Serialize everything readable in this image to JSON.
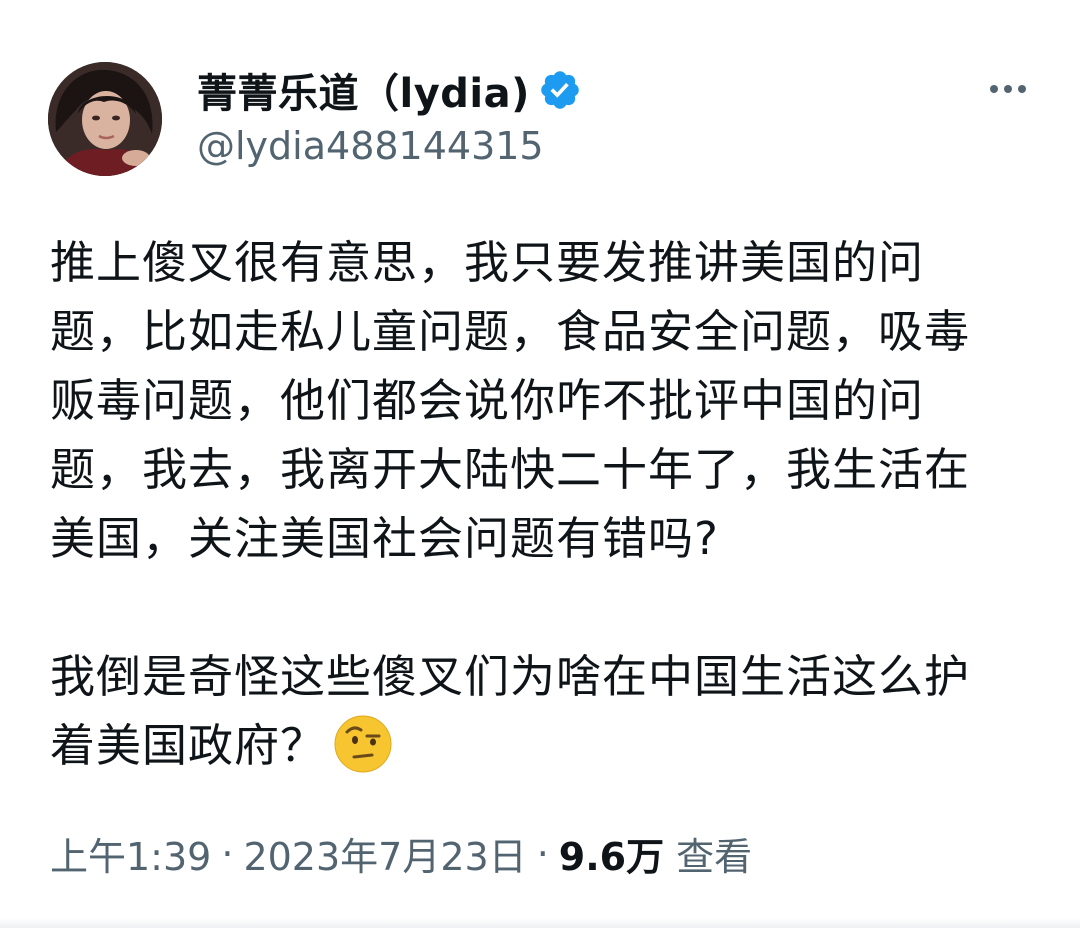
{
  "tweet": {
    "display_name": "菁菁乐道（lydia)",
    "handle": "@lydia488144315",
    "verified_badge_icon": "verified-check-icon",
    "more_icon": "more-horizontal-icon",
    "paragraphs": [
      "推上傻叉很有意思，我只要发推讲美国的问\n题，比如走私儿童问题，食品安全问题，吸毒\n贩毒问题，他们都会说你咋不批评中国的问\n题，我去，我离开大陆快二十年了，我生活在\n美国，关注美国社会问题有错吗?",
      "我倒是奇怪这些傻叉们为啥在中国生活这么护\n着美国政府？"
    ],
    "emoji": "face-with-raised-eyebrow-emoji",
    "time": "上午1:39",
    "separator": "·",
    "date": "2023年7月23日",
    "views_count": "9.6万",
    "views_label": "查看"
  },
  "colors": {
    "text_primary": "#0f1419",
    "text_secondary": "#536471",
    "verified_blue": "#1d9bf0",
    "background": "#ffffff"
  }
}
